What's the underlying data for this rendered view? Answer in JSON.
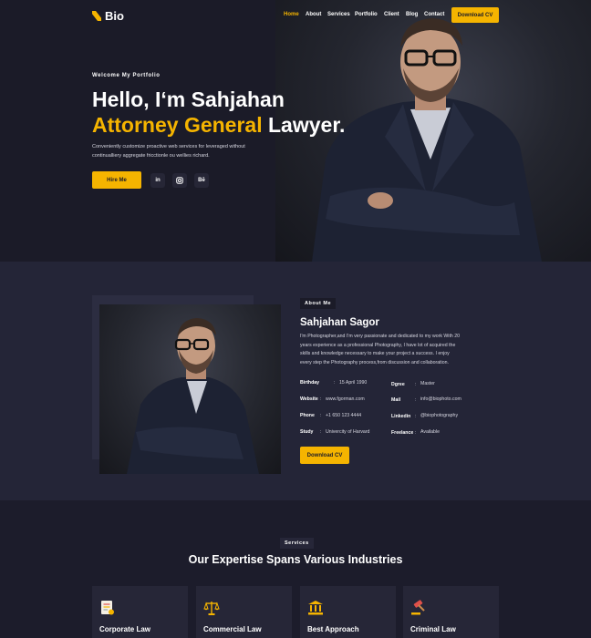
{
  "brand": {
    "name": "Bio",
    "accent": "#f5b400",
    "background": "#1b1b28"
  },
  "nav": {
    "items": [
      "Home",
      "About",
      "Services",
      "Portfolio",
      "Client",
      "Blog",
      "Contact"
    ],
    "active": "Home",
    "cta": "Download CV"
  },
  "hero": {
    "welcome": "Welcome My Portfolio",
    "greeting": "Hello, I‘m Sahjahan",
    "title_accent": "Attorney General",
    "title_rest": " Lawyer.",
    "description": "Conveniently customize proactive web services for leveraged without continualliery aggregate fricctionle ou wellies richard.",
    "hire_button": "Hire Me",
    "socials": [
      {
        "icon": "linkedin-icon",
        "label": "in"
      },
      {
        "icon": "instagram-icon",
        "label": ""
      },
      {
        "icon": "behance-icon",
        "label": "Bē"
      }
    ]
  },
  "about": {
    "tag": "About Me",
    "name": "Sahjahan Sagor",
    "description": "I'm Photographer,and I'm very passionate and dedicated to my work With 20 years experience as a professional Photography, I have lot of acquired the skills and knowledge necessary to make your project a success. I enjoy every step the Photography process,from discussion and collaboration.",
    "info_left": [
      {
        "label": "Birthday",
        "value": "15 April 1990"
      },
      {
        "label": "Website",
        "value": "www.fgorman.com"
      },
      {
        "label": "Phone",
        "value": "+1 650 123 4444"
      },
      {
        "label": "Study",
        "value": "Univercity of Harvard"
      }
    ],
    "info_right": [
      {
        "label": "Dgree",
        "value": "Master"
      },
      {
        "label": "Mail",
        "value": "info@biophoto.com"
      },
      {
        "label": "Linkedin",
        "value": "@biophotography"
      },
      {
        "label": "Freelance",
        "value": "Available"
      }
    ],
    "separator": ":",
    "cv_button": "Download CV"
  },
  "services": {
    "tag": "Services",
    "title": "Our Expertise Spans Various Industries",
    "cards": [
      {
        "title": "Corporate Law",
        "icon": "document-icon"
      },
      {
        "title": "Commercial Law",
        "icon": "scales-icon"
      },
      {
        "title": "Best Approach",
        "icon": "courthouse-icon"
      },
      {
        "title": "Criminal Law",
        "icon": "gavel-icon"
      }
    ]
  }
}
